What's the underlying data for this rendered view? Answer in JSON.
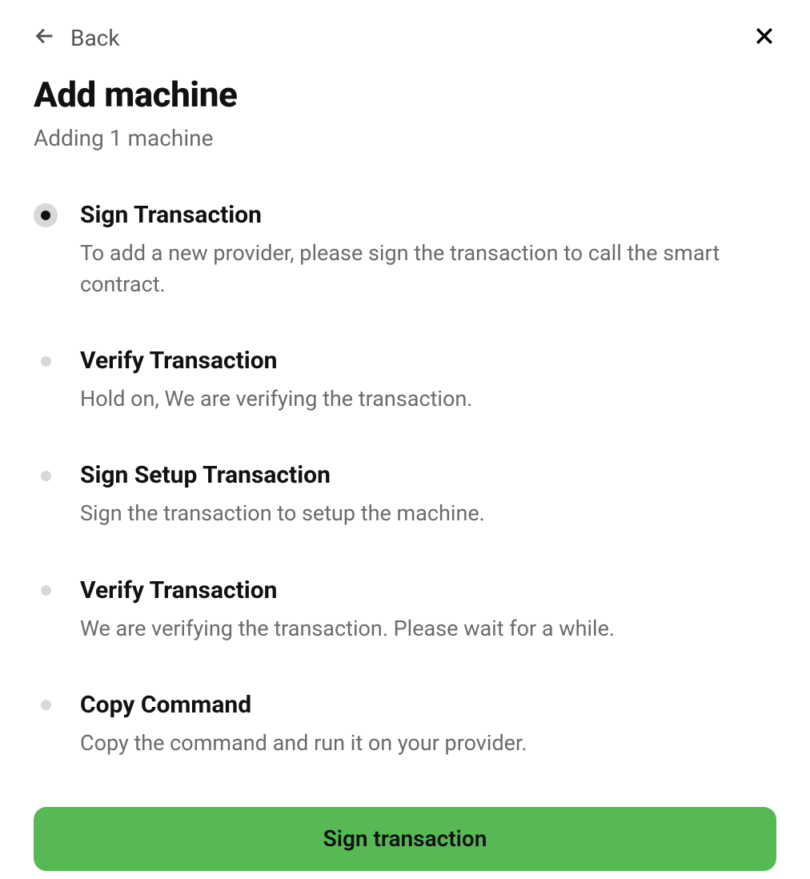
{
  "header": {
    "back_label": "Back"
  },
  "page": {
    "title": "Add machine",
    "subtitle": "Adding 1 machine"
  },
  "steps": [
    {
      "title": "Sign Transaction",
      "desc": "To add a new provider, please sign the transaction to call the smart contract.",
      "active": true
    },
    {
      "title": "Verify Transaction",
      "desc": "Hold on, We are verifying the transaction.",
      "active": false
    },
    {
      "title": "Sign Setup Transaction",
      "desc": "Sign the transaction to setup the machine.",
      "active": false
    },
    {
      "title": "Verify Transaction",
      "desc": "We are verifying the transaction. Please wait for a while.",
      "active": false
    },
    {
      "title": "Copy Command",
      "desc": "Copy the command and run it on your provider.",
      "active": false
    }
  ],
  "action": {
    "label": "Sign transaction"
  }
}
